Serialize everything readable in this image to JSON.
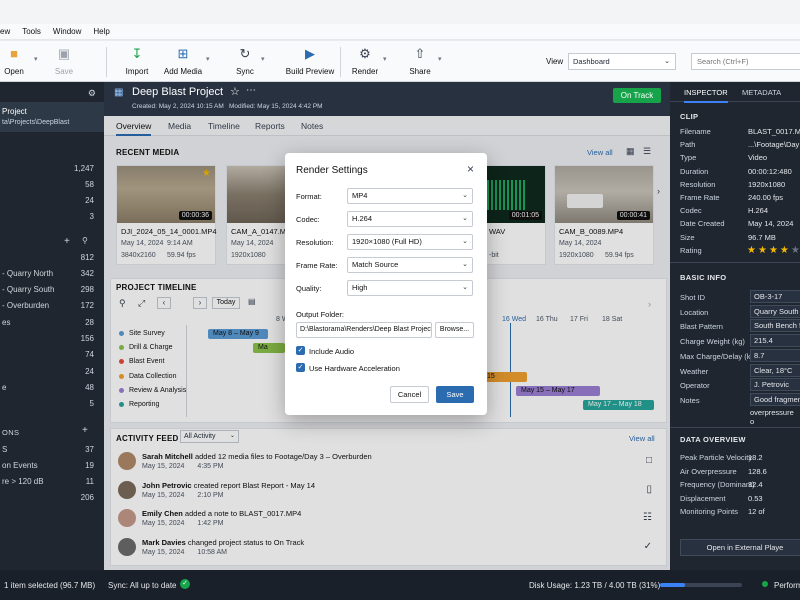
{
  "menu": [
    "View",
    "Tools",
    "Window",
    "Help"
  ],
  "menu_display": [
    "ew",
    "Tools",
    "Window",
    "Help"
  ],
  "toolbar": {
    "open": "Open",
    "save": "Save",
    "import": "Import",
    "add_media": "Add Media",
    "sync": "Sync",
    "build_preview": "Build Preview",
    "render": "Render",
    "share": "Share",
    "view_label": "View",
    "view_value": "Dashboard",
    "search_placeholder": "Search (Ctrl+F)"
  },
  "sidebar": {
    "project_name": "Project",
    "project_path": "ta\\Projects\\DeepBlast",
    "stats": [
      {
        "v": "1,247"
      },
      {
        "v": "58"
      },
      {
        "v": "24"
      },
      {
        "v": "3"
      }
    ],
    "locations": [
      {
        "label": "",
        "v": "812"
      },
      {
        "label": "- Quarry North",
        "v": "342"
      },
      {
        "label": "- Quarry South",
        "v": "298"
      },
      {
        "label": "- Overburden",
        "v": "172"
      },
      {
        "label": "es",
        "v": "28"
      },
      {
        "label": "",
        "v": "156"
      },
      {
        "label": "",
        "v": "74"
      },
      {
        "label": "",
        "v": "24"
      },
      {
        "label": "e",
        "v": "48"
      },
      {
        "label": "",
        "v": "5"
      }
    ],
    "events_header": "ONS",
    "events": [
      {
        "label": "S",
        "v": "37"
      },
      {
        "label": "on Events",
        "v": "19"
      },
      {
        "label": "re > 120 dB",
        "v": "11"
      },
      {
        "label": "",
        "v": "206"
      }
    ]
  },
  "header": {
    "title": "Deep Blast Project",
    "created": "Created: May 2, 2024 10:15 AM",
    "modified": "Modified: May 15, 2024 4:42 PM",
    "status": "On Track"
  },
  "tabs": [
    "Overview",
    "Media",
    "Timeline",
    "Reports",
    "Notes"
  ],
  "recent_media": {
    "title": "RECENT MEDIA",
    "view_all": "View all",
    "cards": [
      {
        "name": "DJI_2024_05_14_0001.MP4",
        "date": "May 14, 2024",
        "time": "9:14 AM",
        "res": "3840x2160",
        "fps": "59.94 fps",
        "dur": "00:00:36"
      },
      {
        "name": "CAM_A_0147.MP4",
        "date": "May 14, 2024",
        "time": "",
        "res": "1920x1080",
        "fps": "",
        "dur": ""
      },
      {
        "name": "WAV",
        "date": "",
        "time": "",
        "res": "-bit",
        "fps": "",
        "dur": "00:01:05"
      },
      {
        "name": "CAM_B_0089.MP4",
        "date": "May 14, 2024",
        "time": "",
        "res": "1920x1080",
        "fps": "59.94 fps",
        "dur": "00:00:41"
      }
    ]
  },
  "timeline": {
    "title": "PROJECT TIMELINE",
    "today": "Today",
    "days": [
      "8 Wed",
      "16 Wed",
      "16 Thu",
      "17 Fri",
      "18 Sat"
    ],
    "rows": [
      {
        "label": "Site Survey",
        "color": "#5b9bd5",
        "bar": "May 8 – May 9"
      },
      {
        "label": "Drill & Charge",
        "color": "#8bc34a",
        "bar": "Ma"
      },
      {
        "label": "Blast Event",
        "color": "#e74c3c",
        "bar": ""
      },
      {
        "label": "Data Collection",
        "color": "#f0a030",
        "bar": "15"
      },
      {
        "label": "Review & Analysis",
        "color": "#9b7fd4",
        "bar": "May 15 – May 17"
      },
      {
        "label": "Reporting",
        "color": "#26a69a",
        "bar": "May 17 – May 18"
      }
    ]
  },
  "activity": {
    "title": "ACTIVITY FEED",
    "filter": "All Activity",
    "view_all": "View all",
    "items": [
      {
        "who": "Sarah Mitchell",
        "what": " added 12 media files to Footage/Day 3 – Overburden",
        "date": "May 15, 2024",
        "time": "4:35 PM",
        "icon": "folder-icon"
      },
      {
        "who": "John Petrovic",
        "what": " created report Blast Report - May 14",
        "date": "May 15, 2024",
        "time": "2:10 PM",
        "icon": "document-icon"
      },
      {
        "who": "Emily Chen",
        "what": " added a note to BLAST_0017.MP4",
        "date": "May 15, 2024",
        "time": "1:42 PM",
        "icon": "note-icon"
      },
      {
        "who": "Mark Davies",
        "what": " changed project status to On Track",
        "date": "May 15, 2024",
        "time": "10:58 AM",
        "icon": "check-circle-icon"
      }
    ]
  },
  "inspector": {
    "tabs": [
      "INSPECTOR",
      "METADATA"
    ],
    "clip_header": "CLIP",
    "clip": [
      {
        "k": "Filename",
        "v": "BLAST_0017.MP4"
      },
      {
        "k": "Path",
        "v": "...\\Footage\\Day"
      },
      {
        "k": "Type",
        "v": "Video"
      },
      {
        "k": "Duration",
        "v": "00:00:12:480"
      },
      {
        "k": "Resolution",
        "v": "1920x1080"
      },
      {
        "k": "Frame Rate",
        "v": "240.00 fps"
      },
      {
        "k": "Codec",
        "v": "H.264"
      },
      {
        "k": "Date Created",
        "v": "May 14, 2024"
      },
      {
        "k": "Size",
        "v": "96.7 MB"
      },
      {
        "k": "Rating",
        "v": ""
      }
    ],
    "rating": 4,
    "basic_header": "BASIC INFO",
    "basic": [
      {
        "k": "Shot ID",
        "v": "OB-3-17"
      },
      {
        "k": "Location",
        "v": "Quarry South"
      },
      {
        "k": "Blast Pattern",
        "v": "South Bench 5"
      },
      {
        "k": "Charge Weight (kg)",
        "v": "215.4"
      },
      {
        "k": "Max Charge/Delay (kg)",
        "v": "8.7"
      },
      {
        "k": "Weather",
        "v": "Clear, 18°C"
      },
      {
        "k": "Operator",
        "v": "J. Petrovic"
      },
      {
        "k": "Notes",
        "v": "Good fragment"
      }
    ],
    "notes_line2": "overpressure o",
    "data_header": "DATA OVERVIEW",
    "data": [
      {
        "k": "Peak Particle Velocity",
        "v": "18.2"
      },
      {
        "k": "Air Overpressure",
        "v": "128.6"
      },
      {
        "k": "Frequency (Dominant)",
        "v": "32.4"
      },
      {
        "k": "Displacement",
        "v": "0.53"
      },
      {
        "k": "Monitoring Points",
        "v": "12 of"
      }
    ],
    "open_external": "Open in External Playe"
  },
  "dialog": {
    "title": "Render Settings",
    "format_label": "Format:",
    "format": "MP4",
    "codec_label": "Codec:",
    "codec": "H.264",
    "resolution_label": "Resolution:",
    "resolution": "1920×1080 (Full HD)",
    "framerate_label": "Frame Rate:",
    "framerate": "Match Source",
    "quality_label": "Quality:",
    "quality": "High",
    "output_label": "Output Folder:",
    "output": "D:\\Blastorama\\Renders\\Deep Blast Project",
    "browse": "Browse...",
    "include_audio": "Include Audio",
    "hw_accel": "Use Hardware Acceleration",
    "cancel": "Cancel",
    "save": "Save"
  },
  "status": {
    "selected": "1 item selected (96.7 MB)",
    "sync": "Sync: All up to date",
    "disk": "Disk Usage: 1.23 TB / 4.00 TB (31%)",
    "disk_fraction": 0.31,
    "perf": "Perform"
  },
  "colors": {
    "accent": "#2b6cb0",
    "status_green": "#16a34a",
    "sidebar": "#1f2630"
  }
}
